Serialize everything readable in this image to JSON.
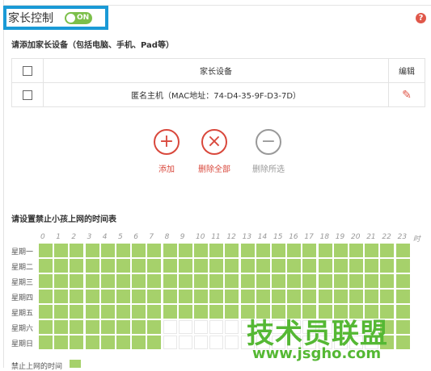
{
  "header": {
    "title": "家长控制",
    "toggle_text": "ON"
  },
  "help_icon": "?",
  "devices": {
    "section_label": "请添加家长设备（包括电脑、手机、Pad等）",
    "columns": [
      "家长设备",
      "编辑"
    ],
    "rows": [
      {
        "device": "匿名主机（MAC地址：74-D4-35-9F-D3-7D）",
        "edit_icon": "edit-icon"
      }
    ]
  },
  "actions": [
    {
      "label": "添加",
      "icon": "plus-icon",
      "glyph": "+"
    },
    {
      "label": "删除全部",
      "icon": "close-icon",
      "glyph": "×"
    },
    {
      "label": "删除所选",
      "icon": "minus-icon",
      "glyph": "−"
    }
  ],
  "schedule": {
    "section_label": "请设置禁止小孩上网的时间表",
    "hours": [
      "0",
      "1",
      "2",
      "3",
      "4",
      "5",
      "6",
      "7",
      "8",
      "9",
      "10",
      "11",
      "12",
      "13",
      "14",
      "15",
      "16",
      "17",
      "18",
      "19",
      "20",
      "21",
      "22",
      "23",
      "时"
    ],
    "days": [
      "星期一",
      "星期二",
      "星期三",
      "星期四",
      "星期五",
      "星期六",
      "星期日"
    ],
    "blocked_ranges": [
      {
        "day": "星期一",
        "from": 0,
        "to": 24
      },
      {
        "day": "星期二",
        "from": 0,
        "to": 24
      },
      {
        "day": "星期三",
        "from": 0,
        "to": 24
      },
      {
        "day": "星期四",
        "from": 0,
        "to": 24
      },
      {
        "day": "星期五",
        "from": 0,
        "to": 24
      },
      {
        "day": "星期六",
        "from": 0,
        "to": 8
      },
      {
        "day": "星期六",
        "from": 22,
        "to": 24
      },
      {
        "day": "星期日",
        "from": 0,
        "to": 8
      },
      {
        "day": "星期日",
        "from": 22,
        "to": 24
      }
    ],
    "legend_label": "禁止上网的时间"
  },
  "watermark": {
    "brand": "技术员联盟",
    "url": "www.jsgho.com"
  },
  "colors": {
    "accent_green": "#a6d16b",
    "toggle_green": "#7cbf4a",
    "danger_red": "#d9483c",
    "focus_blue": "#1a9ad6"
  }
}
